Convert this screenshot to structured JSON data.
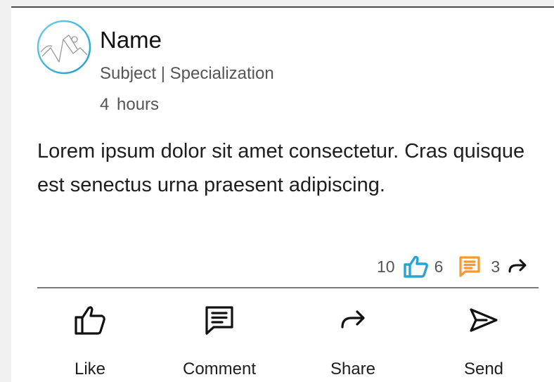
{
  "post": {
    "author_name": "Name",
    "subject": "Subject | Specialization",
    "time": "4  hours",
    "body": "Lorem ipsum dolor sit amet consectetur. Cras quisque est senectus urna praesent adipiscing."
  },
  "stats": {
    "likes": "10",
    "comments": "6",
    "shares": "3",
    "like_icon": "thumbs-up-icon",
    "comment_icon": "comment-icon",
    "share_icon": "share-arrow-icon",
    "like_color": "#29a3d4",
    "comment_color": "#f59a2e"
  },
  "actions": [
    {
      "label": "Like",
      "icon": "thumbs-up-icon"
    },
    {
      "label": "Comment",
      "icon": "comment-icon"
    },
    {
      "label": "Share",
      "icon": "share-arrow-icon"
    },
    {
      "label": "Send",
      "icon": "send-icon"
    }
  ],
  "avatar": {
    "icon": "image-placeholder-icon",
    "ring_color": "#2fb0d8"
  }
}
